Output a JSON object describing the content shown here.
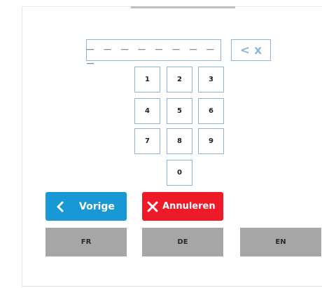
{
  "pin": {
    "display": "_ _ _ _ _ _ _ _ _",
    "backspace_label": "< x"
  },
  "keypad": {
    "k1": "1",
    "k2": "2",
    "k3": "3",
    "k4": "4",
    "k5": "5",
    "k6": "6",
    "k7": "7",
    "k8": "8",
    "k9": "9",
    "k0": "0"
  },
  "actions": {
    "prev_label": "Vorige",
    "prev_icon": "chevron-left-icon",
    "cancel_label": "Annuleren",
    "cancel_icon": "close-icon"
  },
  "languages": [
    "FR",
    "DE",
    "EN"
  ],
  "colors": {
    "accent_blue": "#1898d5",
    "danger_red": "#ef1a28",
    "lang_gray": "#a6a6a6",
    "key_border": "#8db4d8"
  }
}
